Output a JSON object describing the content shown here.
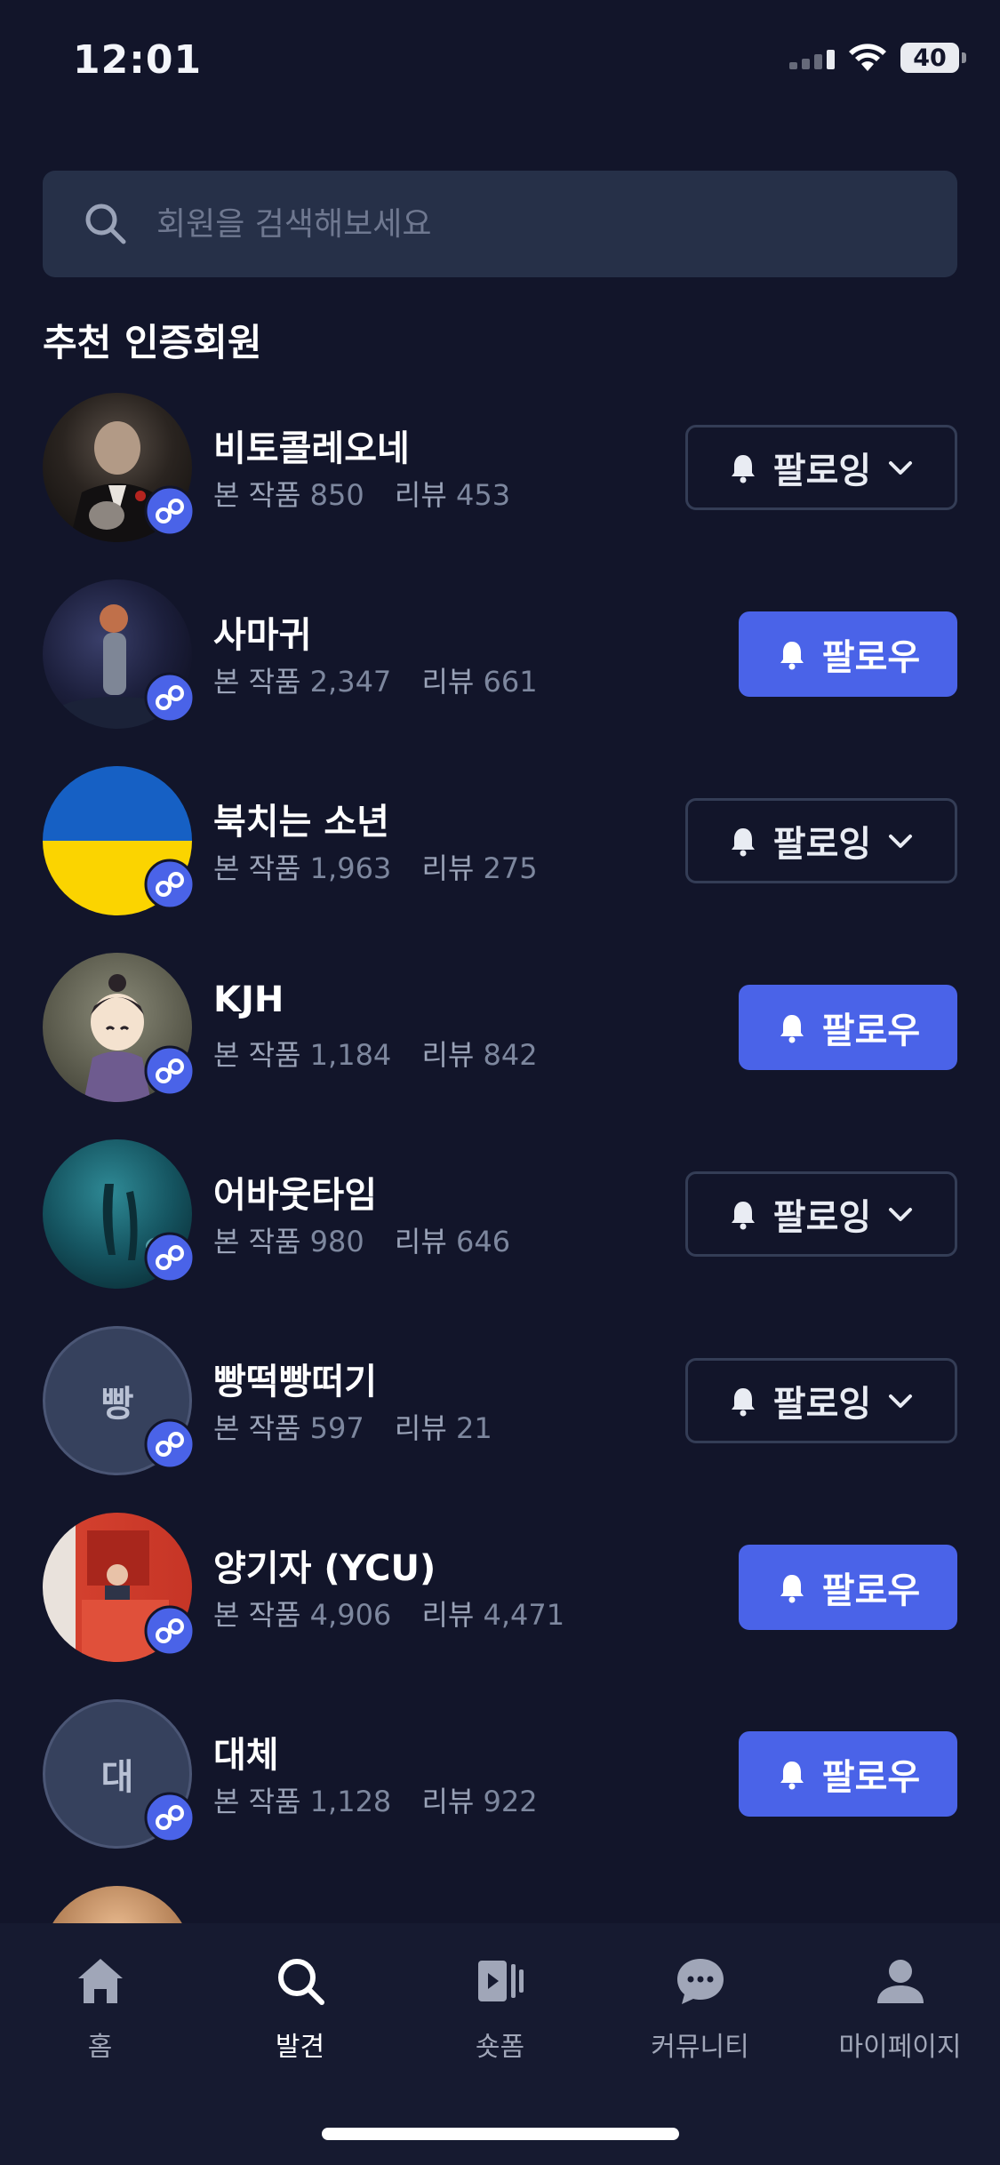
{
  "status_bar": {
    "time": "12:01",
    "battery": "40"
  },
  "search": {
    "placeholder": "회원을 검색해보세요"
  },
  "section": {
    "title": "추천 인증회원"
  },
  "stat_labels": {
    "works": "본 작품",
    "reviews": "리뷰"
  },
  "members": [
    {
      "name": "비토콜레오네",
      "works": "850",
      "reviews": "453",
      "following": true,
      "button_label": "팔로잉",
      "avatar": "photo-portrait-suit"
    },
    {
      "name": "사마귀",
      "works": "2,347",
      "reviews": "661",
      "following": false,
      "button_label": "팔로우",
      "avatar": "photo-night-figure"
    },
    {
      "name": "북치는 소년",
      "works": "1,963",
      "reviews": "275",
      "following": true,
      "button_label": "팔로잉",
      "avatar": "ukraine-flag"
    },
    {
      "name": "KJH",
      "works": "1,184",
      "reviews": "842",
      "following": false,
      "button_label": "팔로우",
      "avatar": "cartoon-character"
    },
    {
      "name": "어바웃타임",
      "works": "980",
      "reviews": "646",
      "following": true,
      "button_label": "팔로잉",
      "avatar": "photo-underwater"
    },
    {
      "name": "빵떡빵떠기",
      "works": "597",
      "reviews": "21",
      "following": true,
      "button_label": "팔로잉",
      "avatar_initial": "빵"
    },
    {
      "name": "양기자 (YCU)",
      "works": "4,906",
      "reviews": "4,471",
      "following": false,
      "button_label": "팔로우",
      "avatar": "photo-red-booth"
    },
    {
      "name": "대체",
      "works": "1,128",
      "reviews": "922",
      "following": false,
      "button_label": "팔로우",
      "avatar_initial": "대"
    }
  ],
  "bottom_nav": [
    {
      "label": "홈",
      "icon": "home-icon",
      "active": false
    },
    {
      "label": "발견",
      "icon": "search-icon",
      "active": true
    },
    {
      "label": "숏폼",
      "icon": "shortform-icon",
      "active": false
    },
    {
      "label": "커뮤니티",
      "icon": "chat-bubble-icon",
      "active": false
    },
    {
      "label": "마이페이지",
      "icon": "profile-icon",
      "active": false
    }
  ],
  "colors": {
    "background": "#12152a",
    "accent": "#4a63e8",
    "search_bg": "#263048"
  }
}
